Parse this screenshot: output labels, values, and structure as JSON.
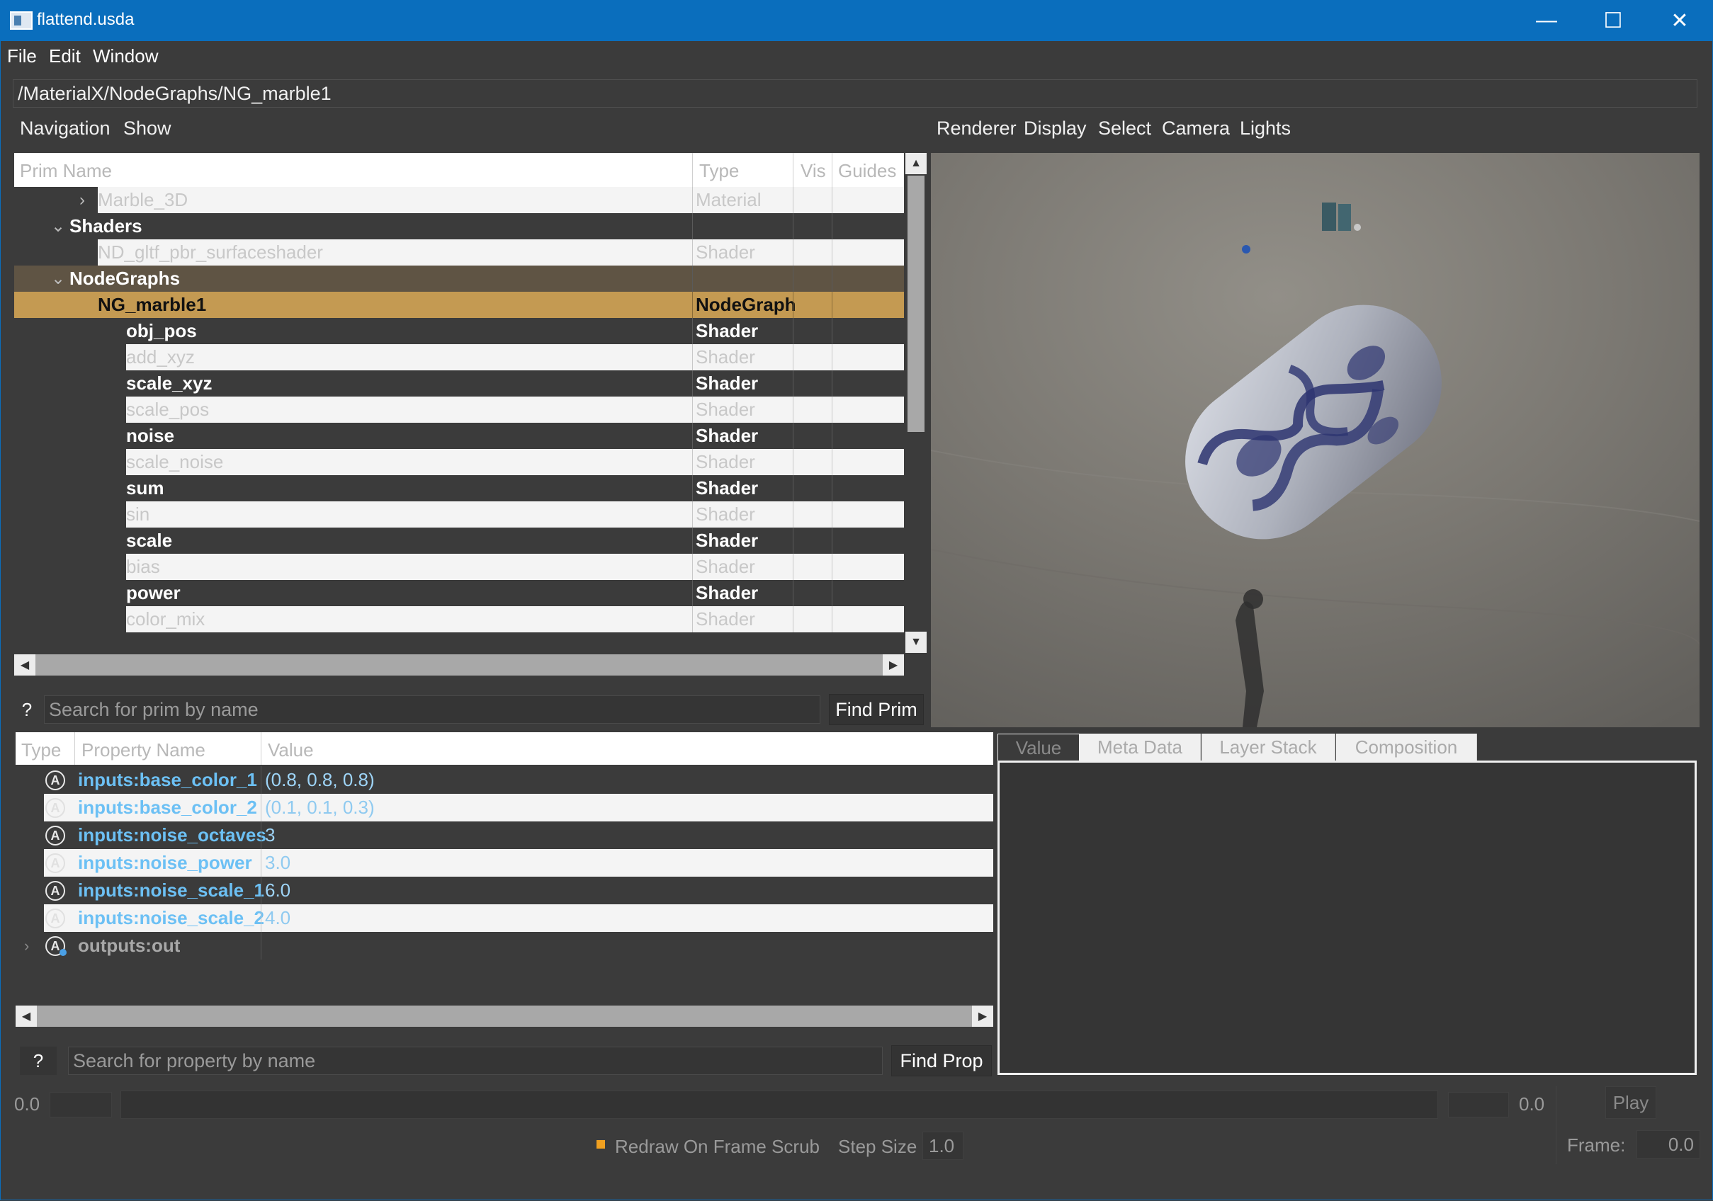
{
  "window": {
    "title": "flattend.usda",
    "minimize": "—",
    "maximize": "☐",
    "close": "✕"
  },
  "menu": [
    "File",
    "Edit",
    "Window"
  ],
  "path": "/MaterialX/NodeGraphs/NG_marble1",
  "left_tabs": [
    "Navigation",
    "Show"
  ],
  "viewport_tabs": [
    "Renderer",
    "Display",
    "Select",
    "Camera",
    "Lights"
  ],
  "prim_table": {
    "headers": [
      "Prim Name",
      "Type",
      "Vis",
      "Guides"
    ],
    "rows": [
      {
        "name": "Marble_3D",
        "type": "Material",
        "indent": 4,
        "arrow": "›",
        "style": "light"
      },
      {
        "name": "Shaders",
        "type": "",
        "indent": 3,
        "arrow": "⌄",
        "style": "dark"
      },
      {
        "name": "ND_gltf_pbr_surfaceshader",
        "type": "Shader",
        "indent": 4,
        "arrow": "",
        "style": "light"
      },
      {
        "name": "NodeGraphs",
        "type": "",
        "indent": 3,
        "arrow": "⌄",
        "style": "parent"
      },
      {
        "name": "NG_marble1",
        "type": "NodeGraph",
        "indent": 4,
        "arrow": "",
        "style": "selected"
      },
      {
        "name": "obj_pos",
        "type": "Shader",
        "indent": 5,
        "arrow": "",
        "style": "dark"
      },
      {
        "name": "add_xyz",
        "type": "Shader",
        "indent": 5,
        "arrow": "",
        "style": "light"
      },
      {
        "name": "scale_xyz",
        "type": "Shader",
        "indent": 5,
        "arrow": "",
        "style": "dark"
      },
      {
        "name": "scale_pos",
        "type": "Shader",
        "indent": 5,
        "arrow": "",
        "style": "light"
      },
      {
        "name": "noise",
        "type": "Shader",
        "indent": 5,
        "arrow": "",
        "style": "dark"
      },
      {
        "name": "scale_noise",
        "type": "Shader",
        "indent": 5,
        "arrow": "",
        "style": "light"
      },
      {
        "name": "sum",
        "type": "Shader",
        "indent": 5,
        "arrow": "",
        "style": "dark"
      },
      {
        "name": "sin",
        "type": "Shader",
        "indent": 5,
        "arrow": "",
        "style": "light"
      },
      {
        "name": "scale",
        "type": "Shader",
        "indent": 5,
        "arrow": "",
        "style": "dark"
      },
      {
        "name": "bias",
        "type": "Shader",
        "indent": 5,
        "arrow": "",
        "style": "light"
      },
      {
        "name": "power",
        "type": "Shader",
        "indent": 5,
        "arrow": "",
        "style": "dark"
      },
      {
        "name": "color_mix",
        "type": "Shader",
        "indent": 5,
        "arrow": "",
        "style": "light"
      }
    ]
  },
  "prim_search": {
    "help": "?",
    "placeholder": "Search for prim by name",
    "button": "Find Prim"
  },
  "prop_table": {
    "headers": [
      "Type",
      "Property Name",
      "Value"
    ],
    "rows": [
      {
        "icon": "A",
        "name": "inputs:base_color_1",
        "value": "(0.8, 0.8, 0.8)",
        "style": "dark"
      },
      {
        "icon": "A",
        "name": "inputs:base_color_2",
        "value": "(0.1, 0.1, 0.3)",
        "style": "light"
      },
      {
        "icon": "A",
        "name": "inputs:noise_octaves",
        "value": "3",
        "style": "dark"
      },
      {
        "icon": "A",
        "name": "inputs:noise_power",
        "value": "3.0",
        "style": "light"
      },
      {
        "icon": "A",
        "name": "inputs:noise_scale_1",
        "value": "6.0",
        "style": "dark"
      },
      {
        "icon": "A",
        "name": "inputs:noise_scale_2",
        "value": "4.0",
        "style": "light"
      },
      {
        "icon": "A",
        "name": "outputs:out",
        "value": "",
        "style": "output"
      }
    ]
  },
  "prop_search": {
    "help": "?",
    "placeholder": "Search for property by name",
    "button": "Find Prop"
  },
  "detail_tabs": [
    "Value",
    "Meta Data",
    "Layer Stack",
    "Composition"
  ],
  "timeline": {
    "start": "0.0",
    "end": "0.0",
    "play": "Play",
    "redraw_label": "Redraw On Frame Scrub",
    "step_label": "Step Size",
    "step_value": "1.0",
    "frame_label": "Frame:",
    "frame_value": "0.0"
  },
  "colors": {
    "accent": "#0a6ebd",
    "selection": "#c49a52",
    "parent_row": "#5f5444",
    "property_blue": "#6cc0f4",
    "checkbox": "#f0a020"
  }
}
